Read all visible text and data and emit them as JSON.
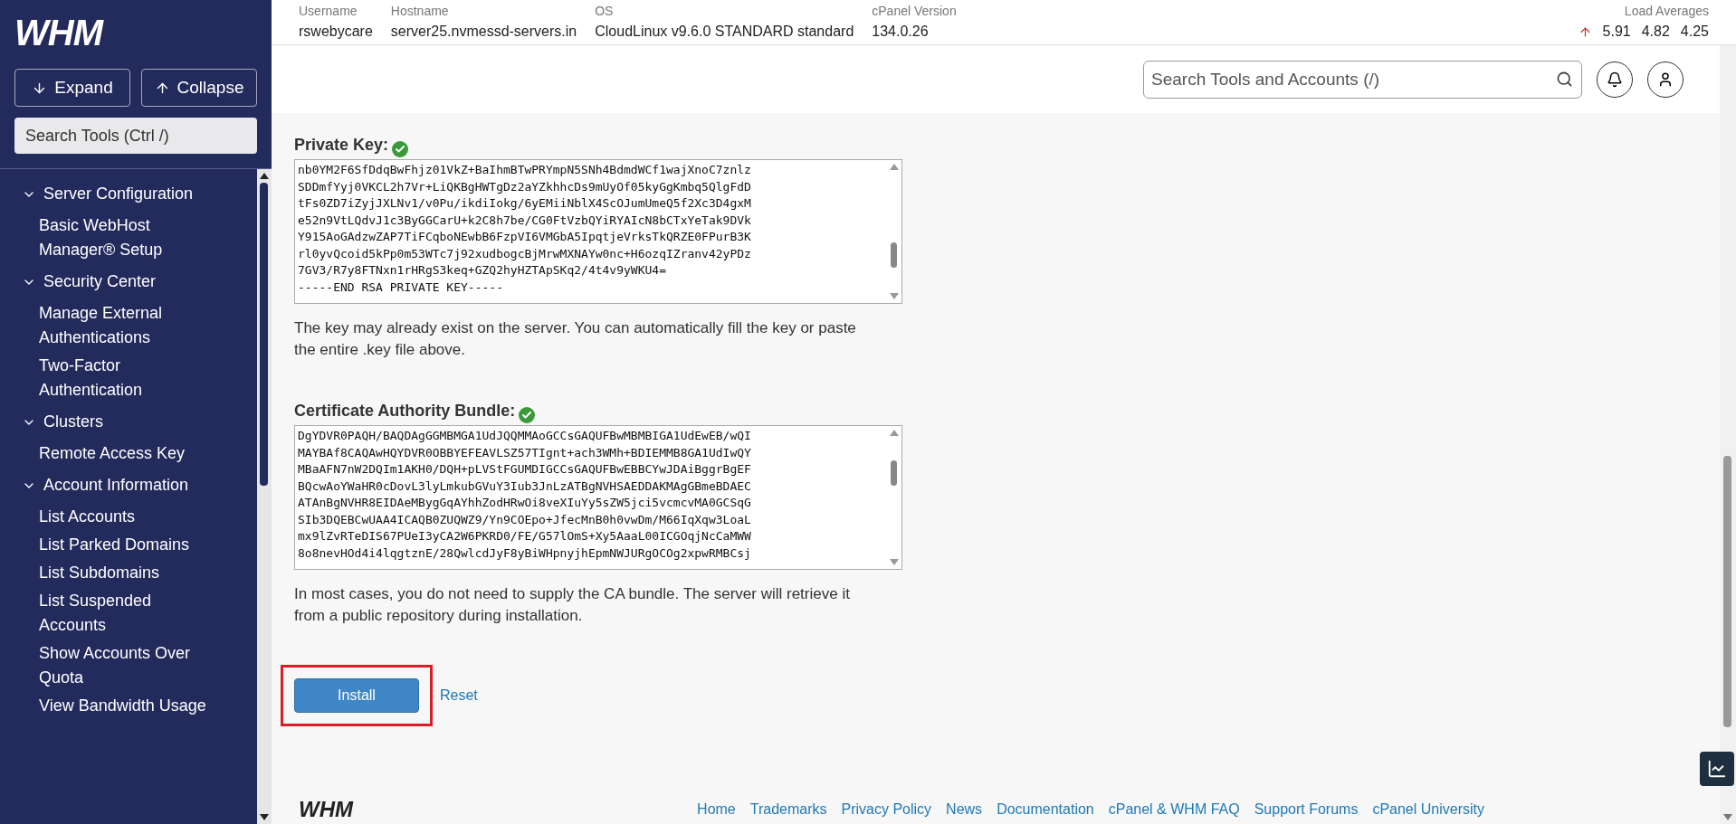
{
  "sidebar": {
    "logo": "WHM",
    "expand_button": "Expand",
    "collapse_button": "Collapse",
    "search": {
      "placeholder": "Search Tools (Ctrl /)"
    },
    "groups": [
      {
        "label": "Server Configuration",
        "expanded": true,
        "children": [
          {
            "label": "Basic WebHost Manager® Setup"
          }
        ]
      },
      {
        "label": "Security Center",
        "expanded": true,
        "children": [
          {
            "label": "Manage External Authentications"
          },
          {
            "label": "Two-Factor Authentication"
          }
        ]
      },
      {
        "label": "Clusters",
        "expanded": true,
        "children": [
          {
            "label": "Remote Access Key"
          }
        ]
      },
      {
        "label": "Account Information",
        "expanded": true,
        "children": [
          {
            "label": "List Accounts"
          },
          {
            "label": "List Parked Domains"
          },
          {
            "label": "List Subdomains"
          },
          {
            "label": "List Suspended Accounts"
          },
          {
            "label": "Show Accounts Over Quota"
          },
          {
            "label": "View Bandwidth Usage"
          }
        ]
      }
    ]
  },
  "server_info": [
    {
      "label": "Username",
      "value": "rswebycare"
    },
    {
      "label": "Hostname",
      "value": "server25.nvmessd-servers.in"
    },
    {
      "label": "OS",
      "value": "CloudLinux v9.6.0 STANDARD standard"
    },
    {
      "label": "cPanel Version",
      "value": "134.0.26"
    }
  ],
  "load_averages": {
    "label": "Load Averages",
    "values": [
      "5.91",
      "4.82",
      "4.25"
    ]
  },
  "top_search": {
    "placeholder": "Search Tools and Accounts (/)"
  },
  "fields": [
    {
      "label": "Private Key:",
      "valid": true,
      "lines": [
        "nb0YM2F6SfDdqBwFhjz01VkZ+BaIhmBTwPRYmpN5SNh4BdmdWCf1wajXnoC7znlz",
        "SDDmfYyj0VKCL2h7Vr+LiQKBgHWTgDz2aYZkhhcDs9mUyOf05kyGgKmbq5QlgFdD",
        "tFs0ZD7iZyjJXLNv1/v0Pu/ikdiIokg/6yEMiiNblX4ScOJumUmeQ5f2Xc3D4gxM",
        "e52n9VtLQdvJ1c3ByGGCarU+k2C8h7be/CG0FtVzbQYiRYAIcN8bCTxYeTak9DVk",
        "Y915AoGAdzwZAP7TiFCqboNEwbB6FzpVI6VMGbA5IpqtjeVrksTkQRZE0FPurB3K",
        "rl0yvQcoid5kPp0m53WTc7j92xudbogcBjMrwMXNAYw0nc+H6ozqIZranv42yPDz",
        "7GV3/R7y8FTNxn1rHRgS3keq+GZQ2hyHZTApSKq2/4t4v9yWKU4=",
        "-----END RSA PRIVATE KEY-----"
      ],
      "help": "The key may already exist on the server. You can automatically fill the key or paste the entire .key file above."
    },
    {
      "label": "Certificate Authority Bundle:",
      "valid": true,
      "lines": [
        "DgYDVR0PAQH/BAQDAgGGMBMGA1UdJQQMMAoGCCsGAQUFBwMBMBIGA1UdEwEB/wQI",
        "MAYBAf8CAQAwHQYDVR0OBBYEFEAVLSZ57TIgnt+ach3WMh+BDIEMMB8GA1UdIwQY",
        "MBaAFN7nW2DQIm1AKH0/DQH+pLVStFGUMDIGCCsGAQUFBwEBBCYwJDAiBggrBgEF",
        "BQcwAoYWaHR0cDovL3lyLmkubGVuY3Iub3JnLzATBgNVHSAEDDAKMAgGBmeBDAEC",
        "ATAnBgNVHR8EIDAeMBygGqAYhhZodHRwOi8veXIuYy5sZW5jci5vcmcvMA0GCSqG",
        "SIb3DQEBCwUAA4ICAQB0ZUQWZ9/Yn9COEpo+JfecMnB0h0vwDm/M66IqXqw3LoaL",
        "mx9lZvRTeDIS67PUeI3yCA2W6PKRD0/FE/G57lOmS+Xy5AaaL00ICGOqjNcCaMWW",
        "8o8nevHOd4i4lqgtznE/28QwlcdJyF8yBiWHpnyjhEpmNWJURgOCOg2xpwRMBCsj"
      ],
      "help": "In most cases, you do not need to supply the CA bundle. The server will retrieve it from a public repository during installation."
    }
  ],
  "install_button": {
    "label": "Install",
    "highlighted": true
  },
  "reset_link": "Reset",
  "footer": {
    "logo": "WHM",
    "links": [
      "Home",
      "Trademarks",
      "Privacy Policy",
      "News",
      "Documentation",
      "cPanel & WHM FAQ",
      "Support Forums",
      "cPanel University"
    ]
  }
}
